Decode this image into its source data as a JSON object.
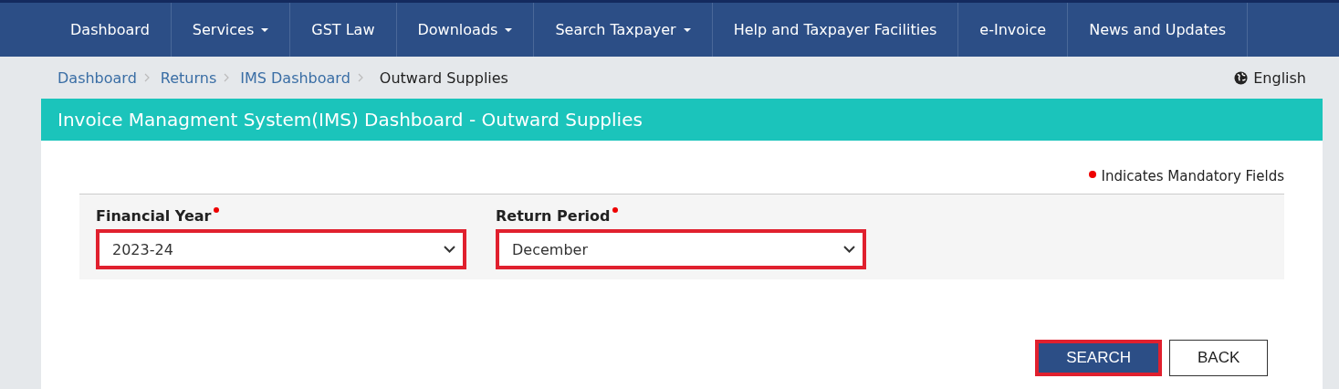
{
  "nav": [
    {
      "label": "Dashboard",
      "has_dropdown": false
    },
    {
      "label": "Services",
      "has_dropdown": true
    },
    {
      "label": "GST Law",
      "has_dropdown": false
    },
    {
      "label": "Downloads",
      "has_dropdown": true
    },
    {
      "label": "Search Taxpayer",
      "has_dropdown": true
    },
    {
      "label": "Help and Taxpayer Facilities",
      "has_dropdown": false
    },
    {
      "label": "e-Invoice",
      "has_dropdown": false
    },
    {
      "label": "News and Updates",
      "has_dropdown": false
    }
  ],
  "breadcrumb": [
    {
      "label": "Dashboard",
      "current": false
    },
    {
      "label": "Returns",
      "current": false
    },
    {
      "label": "IMS Dashboard",
      "current": false
    },
    {
      "label": "Outward Supplies",
      "current": true
    }
  ],
  "language": "English",
  "page_title": "Invoice Managment System(IMS) Dashboard - Outward Supplies",
  "mandatory_note": "Indicates Mandatory Fields",
  "fields": [
    {
      "label": "Financial Year",
      "value": "2023-24",
      "required": true,
      "highlighted": true
    },
    {
      "label": "Return Period",
      "value": "December",
      "required": true,
      "highlighted": true
    }
  ],
  "buttons": [
    {
      "label": "SEARCH",
      "kind": "primary",
      "highlighted": true
    },
    {
      "label": "BACK",
      "kind": "secondary",
      "highlighted": false
    }
  ]
}
